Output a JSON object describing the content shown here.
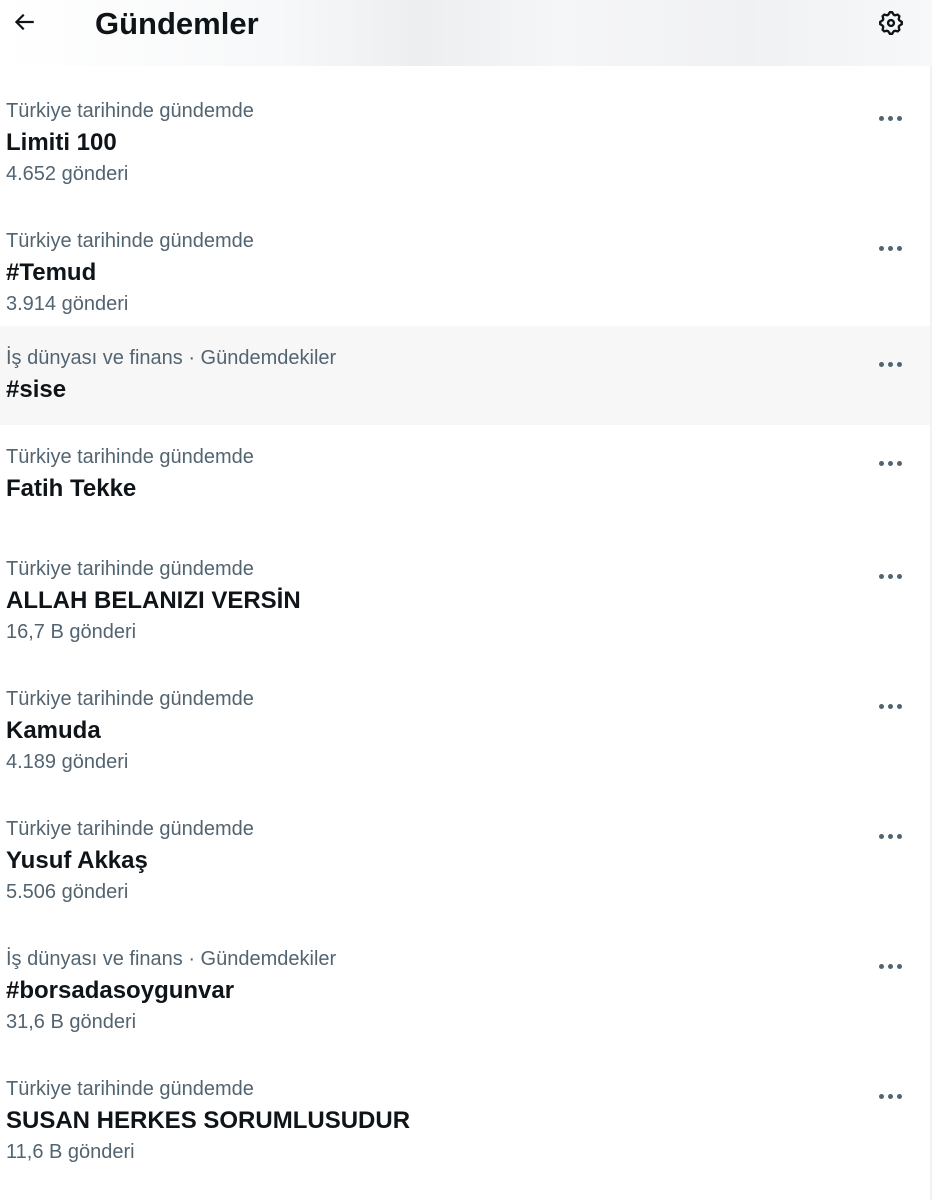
{
  "header": {
    "title": "Gündemler",
    "back_icon": "arrow-left-icon",
    "settings_icon": "gear-icon"
  },
  "trends": [
    {
      "context": "Türkiye tarihinde gündemde",
      "name": "Limiti 100",
      "count": "4.652 gönderi"
    },
    {
      "context": "Türkiye tarihinde gündemde",
      "name": "#Temud",
      "count": "3.914 gönderi"
    },
    {
      "context": "İş dünyası ve finans · Gündemdekiler",
      "name": "#sise",
      "count": null
    },
    {
      "context": "Türkiye tarihinde gündemde",
      "name": "Fatih Tekke",
      "count": null
    },
    {
      "context": "Türkiye tarihinde gündemde",
      "name": "ALLAH BELANIZI VERSİN",
      "count": "16,7 B gönderi"
    },
    {
      "context": "Türkiye tarihinde gündemde",
      "name": "Kamuda",
      "count": "4.189 gönderi"
    },
    {
      "context": "Türkiye tarihinde gündemde",
      "name": "Yusuf Akkaş",
      "count": "5.506 gönderi"
    },
    {
      "context": "İş dünyası ve finans · Gündemdekiler",
      "name": "#borsadasoygunvar",
      "count": "31,6 B gönderi"
    },
    {
      "context": "Türkiye tarihinde gündemde",
      "name": "SUSAN HERKES SORUMLUSUDUR",
      "count": "11,6 B gönderi"
    }
  ],
  "more_icon": "more-horizontal-icon",
  "colors": {
    "primary_text": "#0f1419",
    "secondary_text": "#536471",
    "hover_background": "#f7f7f7"
  }
}
